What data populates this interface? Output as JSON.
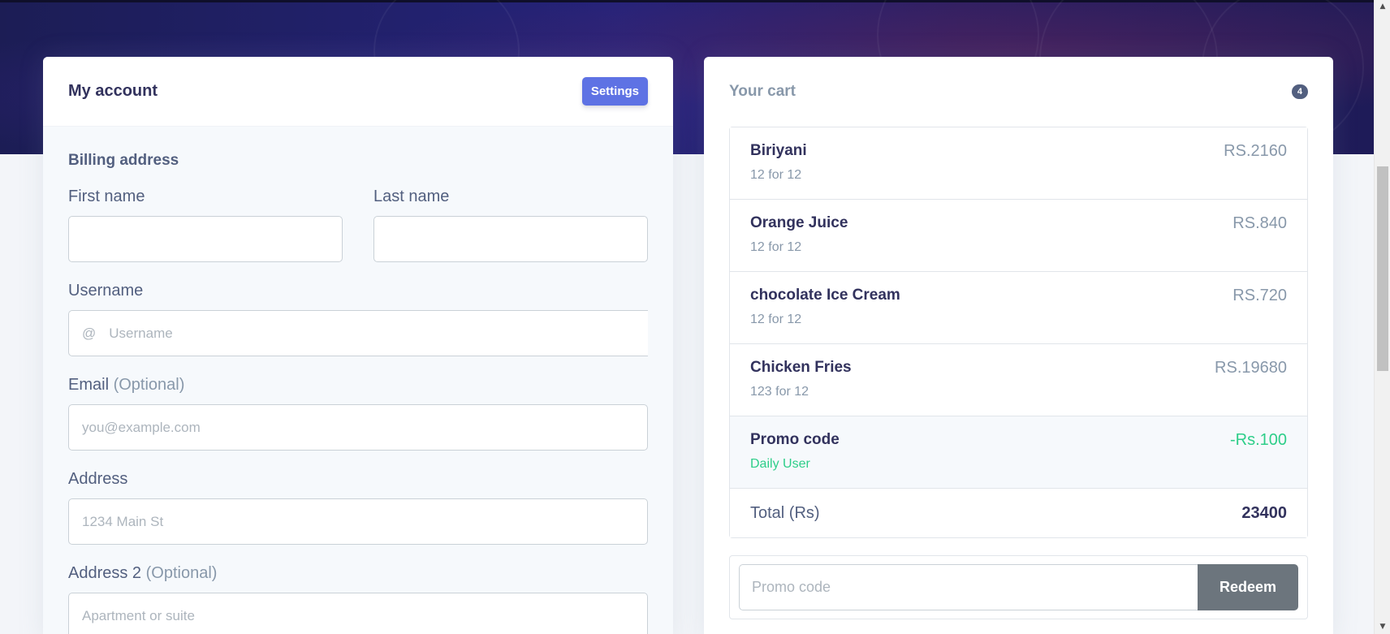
{
  "account": {
    "title": "My account",
    "settings_label": "Settings",
    "billing_heading": "Billing address",
    "first_name": {
      "label": "First name",
      "value": ""
    },
    "last_name": {
      "label": "Last name",
      "value": ""
    },
    "username": {
      "label": "Username",
      "prefix": "@",
      "placeholder": "Username"
    },
    "email": {
      "label": "Email",
      "optional": "(Optional)",
      "placeholder": "you@example.com"
    },
    "address": {
      "label": "Address",
      "placeholder": "1234 Main St"
    },
    "address2": {
      "label": "Address 2",
      "optional": "(Optional)",
      "placeholder": "Apartment or suite"
    }
  },
  "cart": {
    "title": "Your cart",
    "count": "4",
    "items": [
      {
        "name": "Biriyani",
        "detail": "12 for 12",
        "price": "RS.2160"
      },
      {
        "name": "Orange Juice",
        "detail": "12 for 12",
        "price": "RS.840"
      },
      {
        "name": "chocolate Ice Cream",
        "detail": "12 for 12",
        "price": "RS.720"
      },
      {
        "name": "Chicken Fries",
        "detail": "123 for 12",
        "price": "RS.19680"
      }
    ],
    "promo": {
      "name": "Promo code",
      "detail": "Daily User",
      "amount": "-Rs.100"
    },
    "total_label": "Total (Rs)",
    "total_value": "23400",
    "promo_input_placeholder": "Promo code",
    "redeem_label": "Redeem"
  },
  "colors": {
    "primary": "#5e72e4",
    "success": "#2dce89",
    "secondary_button": "#6c757d",
    "hero": "#25237a"
  },
  "icons": [
    "scroll-up-arrow-icon",
    "scroll-down-arrow-icon"
  ]
}
